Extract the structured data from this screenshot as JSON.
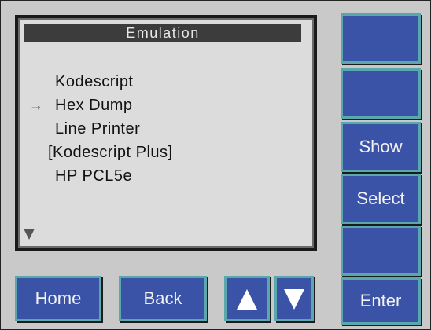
{
  "screen": {
    "title": "Emulation",
    "items": [
      {
        "label": "Kodescript",
        "selected": false
      },
      {
        "label": "Hex Dump",
        "selected": true
      },
      {
        "label": "Line Printer",
        "selected": false
      },
      {
        "label": "[Kodescript Plus]",
        "selected": false
      },
      {
        "label": "HP PCL5e",
        "selected": false
      }
    ],
    "selection_marker": "→",
    "scroll_indicator_icon": "triangle-down-icon"
  },
  "side_buttons": [
    {
      "label": ""
    },
    {
      "label": ""
    },
    {
      "label": "Show"
    },
    {
      "label": "Select"
    },
    {
      "label": ""
    },
    {
      "label": "Enter"
    }
  ],
  "bottom_buttons": {
    "home": "Home",
    "back": "Back",
    "up_icon": "arrow-up-icon",
    "down_icon": "arrow-down-icon"
  },
  "colors": {
    "button_fill": "#3a53a6",
    "button_border": "#5aa8ad",
    "panel": "#c9c9c9",
    "screen": "#dcdcdc",
    "title_bar": "#3c3c3c"
  }
}
